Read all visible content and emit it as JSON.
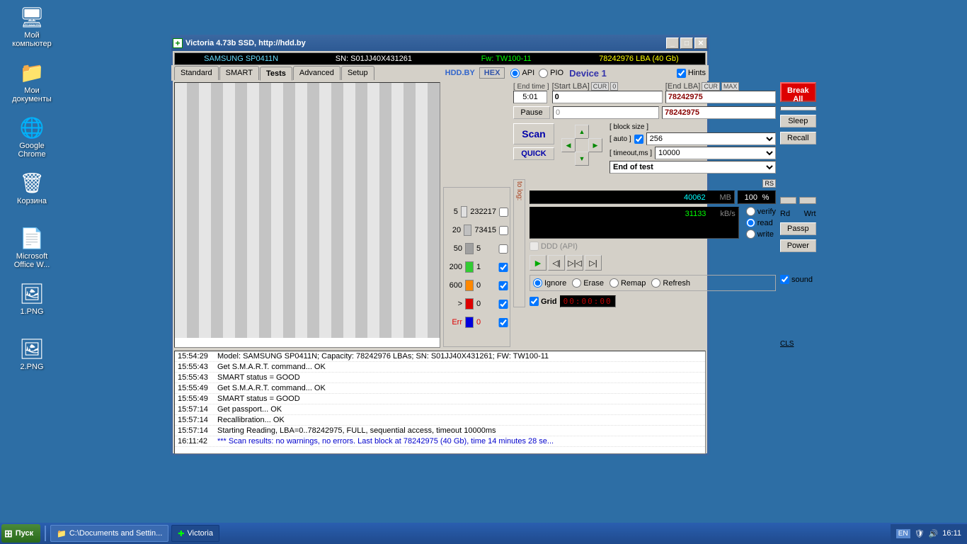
{
  "desktop_icons": [
    {
      "name": "my-computer",
      "label": "Мой\nкомпьютер",
      "glyph": "🖥"
    },
    {
      "name": "my-documents",
      "label": "Мои\nдокументы",
      "glyph": "📁"
    },
    {
      "name": "chrome",
      "label": "Google\nChrome",
      "glyph": "🌐"
    },
    {
      "name": "trash",
      "label": "Корзина",
      "glyph": "🗑"
    },
    {
      "name": "msword",
      "label": "Microsoft\nOffice W...",
      "glyph": "📄"
    },
    {
      "name": "img1",
      "label": "1.PNG",
      "glyph": "🖼"
    },
    {
      "name": "img2",
      "label": "2.PNG",
      "glyph": "🖼"
    }
  ],
  "window": {
    "title": "Victoria 4.73b SSD, http://hdd.by",
    "info": {
      "model": "SAMSUNG SP0411N",
      "sn": "SN: S01JJ40X431261",
      "fw": "Fw: TW100-11",
      "lba": "78242976 LBA (40 Gb)"
    }
  },
  "tabs": [
    "Standard",
    "SMART",
    "Tests",
    "Advanced",
    "Setup"
  ],
  "active_tab": 2,
  "toolbar": {
    "hddby": "HDD.BY",
    "hex": "HEX",
    "api": "API",
    "pio": "PIO",
    "device": "Device 1",
    "hints": "Hints"
  },
  "fields": {
    "end_time_lbl": "[ End time ]",
    "end_time": "5:01",
    "start_lba_lbl": "[Start LBA]",
    "cur": "CUR",
    "zero": "0",
    "start_lba": "0",
    "end_lba_lbl": "[End LBA]",
    "max": "MAX",
    "end_lba": "78242975",
    "pos_lba": "0",
    "pos_end": "78242975",
    "pause": "Pause",
    "scan": "Scan",
    "quick": "QUICK",
    "block_size_lbl": "[ block size ]",
    "auto_lbl": "[ auto ]",
    "block_size": "256",
    "timeout_lbl": "[ timeout,ms ]",
    "timeout": "10000",
    "end_of_test": "End of test",
    "rs": "RS",
    "to_log": "to log:",
    "mb": "40062",
    "mb_unit": "MB",
    "pct": "100",
    "pct_unit": "%",
    "kbs": "31133",
    "kbs_unit": "kB/s",
    "ddd": "DDD (API)",
    "verify": "verify",
    "read": "read",
    "write": "write",
    "ignore": "Ignore",
    "erase": "Erase",
    "remap": "Remap",
    "refresh": "Refresh",
    "grid": "Grid",
    "timer": "00:00:00"
  },
  "side": {
    "break_all": "Break All",
    "sleep": "Sleep",
    "recall": "Recall",
    "rd": "Rd",
    "wrt": "Wrt",
    "passp": "Passp",
    "power": "Power",
    "sound": "sound",
    "cls": "CLS"
  },
  "legend": [
    {
      "lbl": "5",
      "color": "#e0e0e0",
      "cnt": "232217"
    },
    {
      "lbl": "20",
      "color": "#c0c0c0",
      "cnt": "73415"
    },
    {
      "lbl": "50",
      "color": "#a0a0a0",
      "cnt": "5"
    },
    {
      "lbl": "200",
      "color": "#3c3",
      "cnt": "1"
    },
    {
      "lbl": "600",
      "color": "#f80",
      "cnt": "0"
    },
    {
      "lbl": ">",
      "color": "#d00",
      "cnt": "0"
    },
    {
      "lbl": "Err",
      "color": "#00d",
      "cnt": "0"
    }
  ],
  "log": [
    {
      "t": "15:54:29",
      "m": "Model: SAMSUNG SP0411N; Capacity: 78242976 LBAs; SN: S01JJ40X431261; FW: TW100-11"
    },
    {
      "t": "15:55:43",
      "m": "Get S.M.A.R.T. command... OK"
    },
    {
      "t": "15:55:43",
      "m": "SMART status = GOOD"
    },
    {
      "t": "15:55:49",
      "m": "Get S.M.A.R.T. command... OK"
    },
    {
      "t": "15:55:49",
      "m": "SMART status = GOOD"
    },
    {
      "t": "15:57:14",
      "m": "Get passport... OK"
    },
    {
      "t": "15:57:14",
      "m": "Recallibration... OK"
    },
    {
      "t": "15:57:14",
      "m": "Starting Reading, LBA=0..78242975, FULL, sequential access, timeout 10000ms"
    },
    {
      "t": "16:11:42",
      "m": "*** Scan results: no warnings, no errors. Last block at 78242975 (40 Gb), time 14 minutes 28 se...",
      "blue": true
    }
  ],
  "taskbar": {
    "start": "Пуск",
    "tasks": [
      "C:\\Documents and Settin...",
      "Victoria"
    ],
    "lang": "EN",
    "clock": "16:11"
  }
}
